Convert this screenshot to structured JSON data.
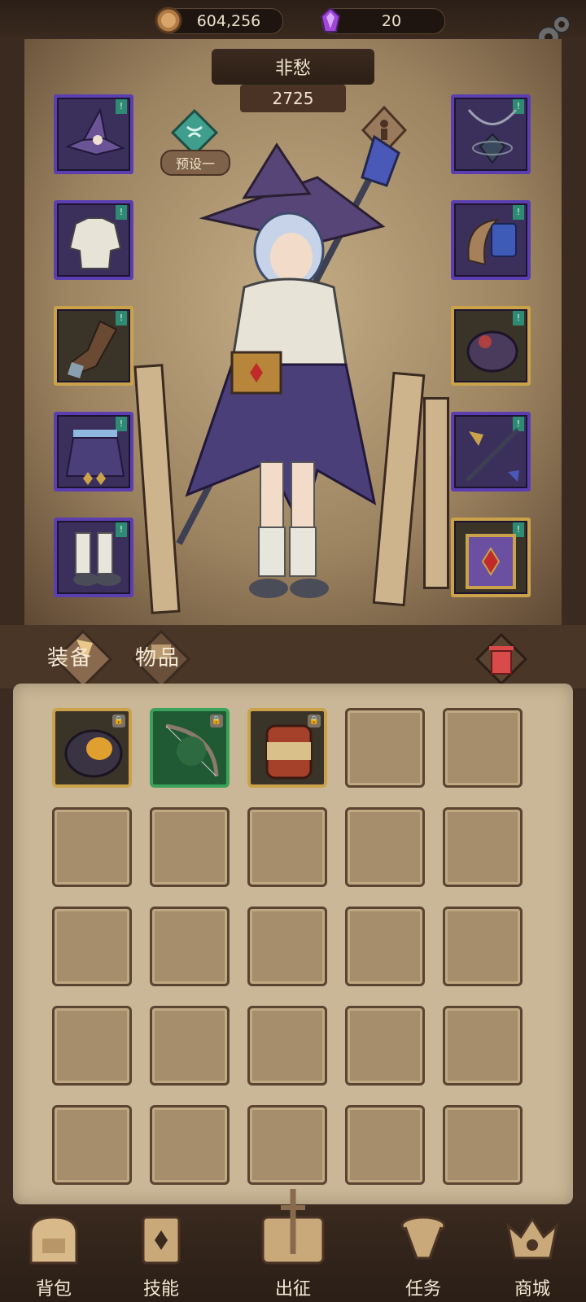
{
  "currencies": {
    "gold": {
      "value": "604,256",
      "icon": "gold-coin-icon"
    },
    "gem": {
      "value": "20",
      "icon": "purple-crystal-icon"
    }
  },
  "settings_icon": "gear-icon",
  "character": {
    "name": "非愁",
    "power": "2725",
    "preset_label": "预设一"
  },
  "equipment_left": [
    {
      "icon": "witch-hat-icon",
      "rarity": "purple"
    },
    {
      "icon": "shirt-icon",
      "rarity": "purple"
    },
    {
      "icon": "gloves-icon",
      "rarity": "gold"
    },
    {
      "icon": "skirt-icon",
      "rarity": "purple"
    },
    {
      "icon": "boots-icon",
      "rarity": "purple"
    }
  ],
  "equipment_right": [
    {
      "icon": "necklace-icon",
      "rarity": "purple"
    },
    {
      "icon": "bracer-icon",
      "rarity": "purple"
    },
    {
      "icon": "ring-icon",
      "rarity": "gold"
    },
    {
      "icon": "staff-icon",
      "rarity": "purple"
    },
    {
      "icon": "spellbook-icon",
      "rarity": "gold"
    }
  ],
  "tabs": {
    "equipment": "装备",
    "items": "物品"
  },
  "trash_icon": "trash-icon",
  "inventory": [
    {
      "icon": "dark-ring-icon",
      "rarity": "gold",
      "locked": true
    },
    {
      "icon": "bow-icon",
      "rarity": "green",
      "locked": true
    },
    {
      "icon": "bracer-icon",
      "rarity": "gold",
      "locked": true
    }
  ],
  "nav": [
    {
      "label": "背包",
      "icon": "backpack-icon"
    },
    {
      "label": "技能",
      "icon": "skill-card-icon"
    },
    {
      "label": "出征",
      "icon": "expedition-sword-icon"
    },
    {
      "label": "任务",
      "icon": "quest-scroll-icon"
    },
    {
      "label": "商城",
      "icon": "shop-crown-icon"
    }
  ]
}
